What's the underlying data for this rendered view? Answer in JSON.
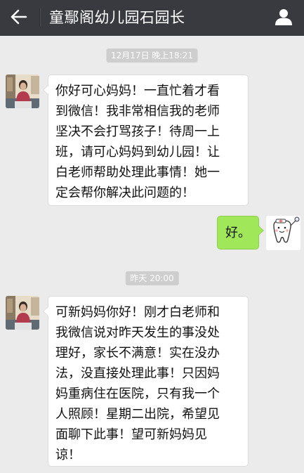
{
  "header": {
    "title": "童鄢阁幼儿园石园长",
    "back_icon": "arrow-left-icon",
    "profile_icon": "person-icon"
  },
  "messages": [
    {
      "kind": "timestamp",
      "text": "12月17日 晚上18:21"
    },
    {
      "kind": "incoming",
      "avatar": "contact-avatar",
      "text": "你好可心妈妈！一直忙着才看\n到微信！我非常相信我的老师\n坚决不会打骂孩子！待周一上\n班，请可心妈妈到幼儿园！让\n白老师帮助处理此事情！她一\n定会帮你解决此问题的！"
    },
    {
      "kind": "outgoing",
      "avatar": "tooth-cartoon-avatar",
      "text": "好。"
    },
    {
      "kind": "timestamp",
      "text": "昨天 20:00"
    },
    {
      "kind": "incoming",
      "avatar": "contact-avatar",
      "text": "可新妈妈你好！刚才白老师和\n我微信说对昨天发生的事没处\n理好，家长不满意！实在没办\n法，没直接处理此事！只因妈\n妈重病住在医院，只有我一个\n人照顾！星期二出院，希望见\n面聊下此事！望可新妈妈见\n谅！"
    }
  ],
  "colors": {
    "topbar": "#393a3f",
    "chat_background": "#ebebeb",
    "outgoing_bubble": "#a0e75a",
    "incoming_bubble": "#ffffff",
    "timestamp_badge": "#cecece"
  }
}
